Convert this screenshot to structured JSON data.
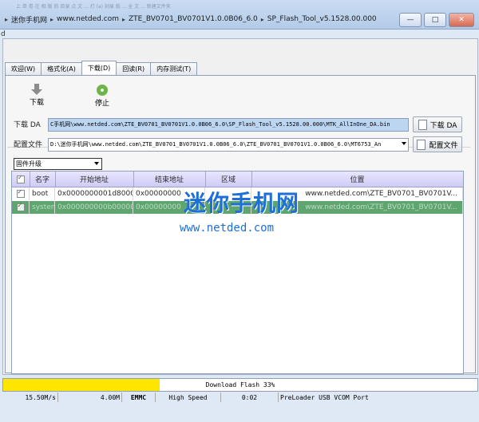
{
  "explorer": {
    "faint_top": "上 单 卷 在 相 版 的 目录 点 文 ... 打 (a) 刻录 版 ... 全 文 ... 新建文件夹",
    "breadcrumbs": [
      "迷你手机网",
      "www.netded.com",
      "ZTE_BV0701_BV0701V1.0.0B06_6.0",
      "SP_Flash_Tool_v5.1528.00.000"
    ],
    "controls": {
      "minimize": "—",
      "maximize": "□",
      "close": "✕"
    }
  },
  "menu_glyph": "d",
  "tabs": [
    {
      "label": "欢迎(W)",
      "active": false
    },
    {
      "label": "格式化(A)",
      "active": false
    },
    {
      "label": "下载(D)",
      "active": true
    },
    {
      "label": "回读(R)",
      "active": false
    },
    {
      "label": "内存测试(T)",
      "active": false
    }
  ],
  "toolbar": {
    "download": "下载",
    "stop": "停止"
  },
  "da": {
    "label": "下载 DA",
    "path": "C手机网\\www.netded.com\\ZTE_BV0701_BV0701V1.0.0B06_6.0\\SP_Flash_Tool_v5.1528.00.000\\MTK_AllInOne_DA.bin",
    "button": "下载 DA"
  },
  "scatter": {
    "label": "配置文件",
    "path": "D:\\迷你手机网\\www.netded.com\\ZTE_BV0701_BV0701V1.0.0B06_6.0\\ZTE_BV0701_BV0701V1.0.0B06_6.0\\MT6753_An",
    "button": "配置文件"
  },
  "mode_select": {
    "value": "固件升级"
  },
  "table": {
    "headers": [
      "名字",
      "开始地址",
      "结束地址",
      "区域",
      "位置"
    ],
    "rows": [
      {
        "checked": true,
        "selected": false,
        "name": "boot",
        "start": "0x0000000001d80000",
        "end": "0x00000000",
        "region": "",
        "location": "www.netded.com\\ZTE_BV0701_BV0701V..."
      },
      {
        "checked": true,
        "selected": true,
        "name": "system",
        "start": "0x000000000b000000",
        "end": "0x00000000",
        "region": "",
        "location": "www.netded.com\\ZTE_BV0701_BV0701V..."
      }
    ]
  },
  "watermark": {
    "title": "迷你手机网",
    "url": "www.netded.com"
  },
  "progress": {
    "text": "Download Flash 33%",
    "fraction": 0.33,
    "color": "#ffe500"
  },
  "status": {
    "speed": "15.50M/s",
    "size": "4.00M",
    "storage": "EMMC",
    "usb": "High Speed",
    "time": "0:02",
    "port": "PreLoader USB VCOM Port"
  },
  "colors": {
    "selected_row": "#5ea56f",
    "header_bg": "#d7d5f7",
    "watermark": "#1f6fd8"
  }
}
